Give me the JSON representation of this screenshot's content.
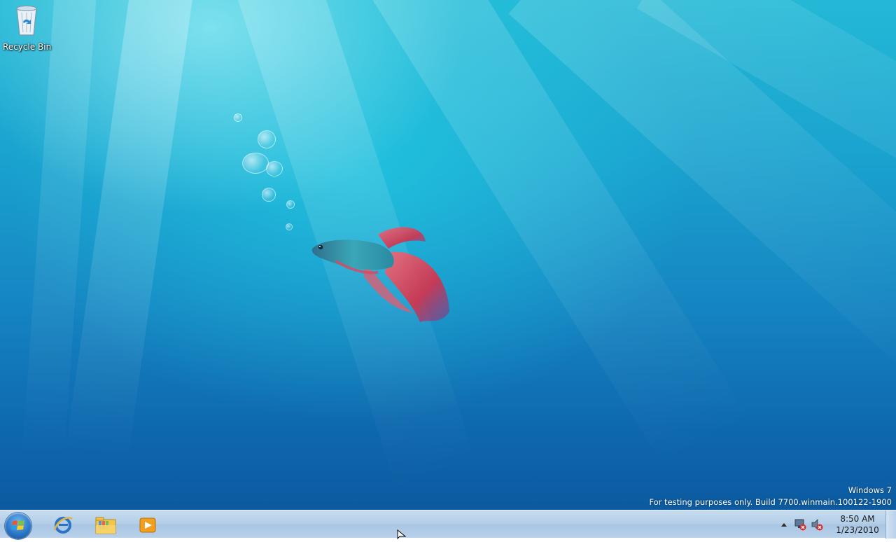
{
  "desktop": {
    "icons": [
      {
        "label": "Recycle Bin",
        "icon": "recycle-bin-icon"
      }
    ],
    "wallpaper": "betta-fish-aqua",
    "watermark": {
      "line1": "Windows 7",
      "line2": "For testing purposes only. Build 7700.winmain.100122-1900"
    }
  },
  "taskbar": {
    "start_icon": "windows-orb-icon",
    "pinned": [
      {
        "name": "internet-explorer",
        "icon": "internet-explorer-icon"
      },
      {
        "name": "windows-explorer",
        "icon": "folder-library-icon"
      },
      {
        "name": "media-player",
        "icon": "media-player-icon"
      }
    ],
    "tray": {
      "icons": [
        "show-hidden-icons-arrow-icon",
        "network-disconnected-icon",
        "volume-muted-icon"
      ],
      "time": "8:50 AM",
      "date": "1/23/2010"
    }
  },
  "colors": {
    "taskbar": "#b5cfe8",
    "accent": "#2b78c9",
    "watermark_text": "#ffffff"
  }
}
